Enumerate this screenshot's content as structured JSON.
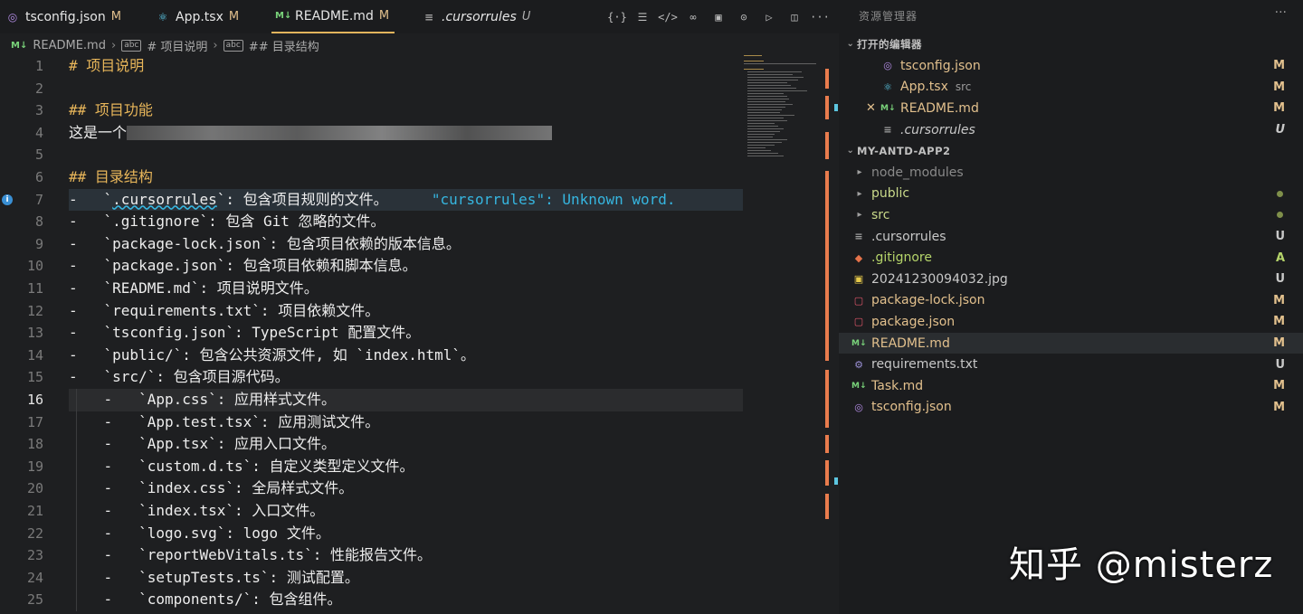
{
  "tabs": [
    {
      "label": "tsconfig.json",
      "status": "M",
      "icon": "tsconfig-icon",
      "active": false
    },
    {
      "label": "App.tsx",
      "status": "M",
      "icon": "react-icon",
      "active": false
    },
    {
      "label": "README.md",
      "status": "M",
      "icon": "markdown-icon",
      "active": true
    },
    {
      "label": ".cursorrules",
      "status": "U",
      "icon": "lines-icon",
      "active": false
    }
  ],
  "toolbar": [
    "braces-icon",
    "list-icon",
    "code-icon",
    "link-icon",
    "image-icon",
    "more-circle-icon",
    "run-icon",
    "split-icon",
    "more-icon"
  ],
  "breadcrumb": {
    "file": "README.md",
    "h1": "# 项目说明",
    "h2": "## 目录结构"
  },
  "editor": {
    "current_line": 16,
    "lines": [
      {
        "n": "1",
        "text": "# 项目说明"
      },
      {
        "n": "2",
        "text": ""
      },
      {
        "n": "3",
        "text": "## 项目功能"
      },
      {
        "n": "4",
        "text": "这是一个"
      },
      {
        "n": "5",
        "text": ""
      },
      {
        "n": "6",
        "text": "## 目录结构"
      },
      {
        "n": "7",
        "text": "-   `.cursorrules`: 包含项目规则的文件。"
      },
      {
        "n": "8",
        "text": "-   `.gitignore`: 包含 Git 忽略的文件。"
      },
      {
        "n": "9",
        "text": "-   `package-lock.json`: 包含项目依赖的版本信息。"
      },
      {
        "n": "10",
        "text": "-   `package.json`: 包含项目依赖和脚本信息。"
      },
      {
        "n": "11",
        "text": "-   `README.md`: 项目说明文件。"
      },
      {
        "n": "12",
        "text": "-   `requirements.txt`: 项目依赖文件。"
      },
      {
        "n": "13",
        "text": "-   `tsconfig.json`: TypeScript 配置文件。"
      },
      {
        "n": "14",
        "text": "-   `public/`: 包含公共资源文件, 如 `index.html`。"
      },
      {
        "n": "15",
        "text": "-   `src/`: 包含项目源代码。"
      },
      {
        "n": "16",
        "text": "    -   `App.css`: 应用样式文件。"
      },
      {
        "n": "17",
        "text": "    -   `App.test.tsx`: 应用测试文件。"
      },
      {
        "n": "18",
        "text": "    -   `App.tsx`: 应用入口文件。"
      },
      {
        "n": "19",
        "text": "    -   `custom.d.ts`: 自定义类型定义文件。"
      },
      {
        "n": "20",
        "text": "    -   `index.css`: 全局样式文件。"
      },
      {
        "n": "21",
        "text": "    -   `index.tsx`: 入口文件。"
      },
      {
        "n": "22",
        "text": "    -   `logo.svg`: logo 文件。"
      },
      {
        "n": "23",
        "text": "    -   `reportWebVitals.ts`: 性能报告文件。"
      },
      {
        "n": "24",
        "text": "    -   `setupTests.ts`: 测试配置。"
      },
      {
        "n": "25",
        "text": "    -   `components/`: 包含组件。"
      }
    ],
    "diagnostic": "\"cursorrules\": Unknown word."
  },
  "explorer": {
    "title": "资源管理器",
    "open_editors_label": "打开的编辑器",
    "open_editors": [
      {
        "label": "tsconfig.json",
        "sub": "",
        "status": "M",
        "icon": "tsconfig-icon"
      },
      {
        "label": "App.tsx",
        "sub": "src",
        "status": "M",
        "icon": "react-icon"
      },
      {
        "label": "README.md",
        "sub": "",
        "status": "M",
        "icon": "markdown-icon"
      },
      {
        "label": ".cursorrules",
        "sub": "",
        "status": "U",
        "icon": "lines-icon"
      }
    ],
    "project_label": "MY-ANTD-APP2",
    "files": [
      {
        "label": "node_modules",
        "type": "folder",
        "status": "",
        "color": "#8a8a8a"
      },
      {
        "label": "public",
        "type": "folder",
        "status": "dot",
        "color": "#c9d98a"
      },
      {
        "label": "src",
        "type": "folder",
        "status": "dot",
        "color": "#c9d98a"
      },
      {
        "label": ".cursorrules",
        "type": "file",
        "status": "U",
        "color": "#c8c8c8",
        "icon": "lines-icon"
      },
      {
        "label": ".gitignore",
        "type": "file",
        "status": "A",
        "color": "#b5d46a",
        "icon": "git-icon"
      },
      {
        "label": "20241230094032.jpg",
        "type": "file",
        "status": "U",
        "color": "#c8c8c8",
        "icon": "image-file-icon"
      },
      {
        "label": "package-lock.json",
        "type": "file",
        "status": "M",
        "color": "#e2c08d",
        "icon": "npm-icon"
      },
      {
        "label": "package.json",
        "type": "file",
        "status": "M",
        "color": "#e2c08d",
        "icon": "npm-icon"
      },
      {
        "label": "README.md",
        "type": "file",
        "status": "M",
        "color": "#e2c08d",
        "icon": "markdown-icon"
      },
      {
        "label": "requirements.txt",
        "type": "file",
        "status": "U",
        "color": "#c8c8c8",
        "icon": "gear-icon"
      },
      {
        "label": "Task.md",
        "type": "file",
        "status": "M",
        "color": "#e2c08d",
        "icon": "markdown-icon"
      },
      {
        "label": "tsconfig.json",
        "type": "file",
        "status": "M",
        "color": "#e2c08d",
        "icon": "tsconfig-icon"
      }
    ]
  },
  "watermark": "知乎 @misterz",
  "colors": {
    "modified": "#e2c08d",
    "untracked": "#c8c8c8",
    "added": "#b5d46a",
    "heading": "#e8b65a",
    "diagnostic": "#36b6e0",
    "accent": "#e2b45c"
  }
}
